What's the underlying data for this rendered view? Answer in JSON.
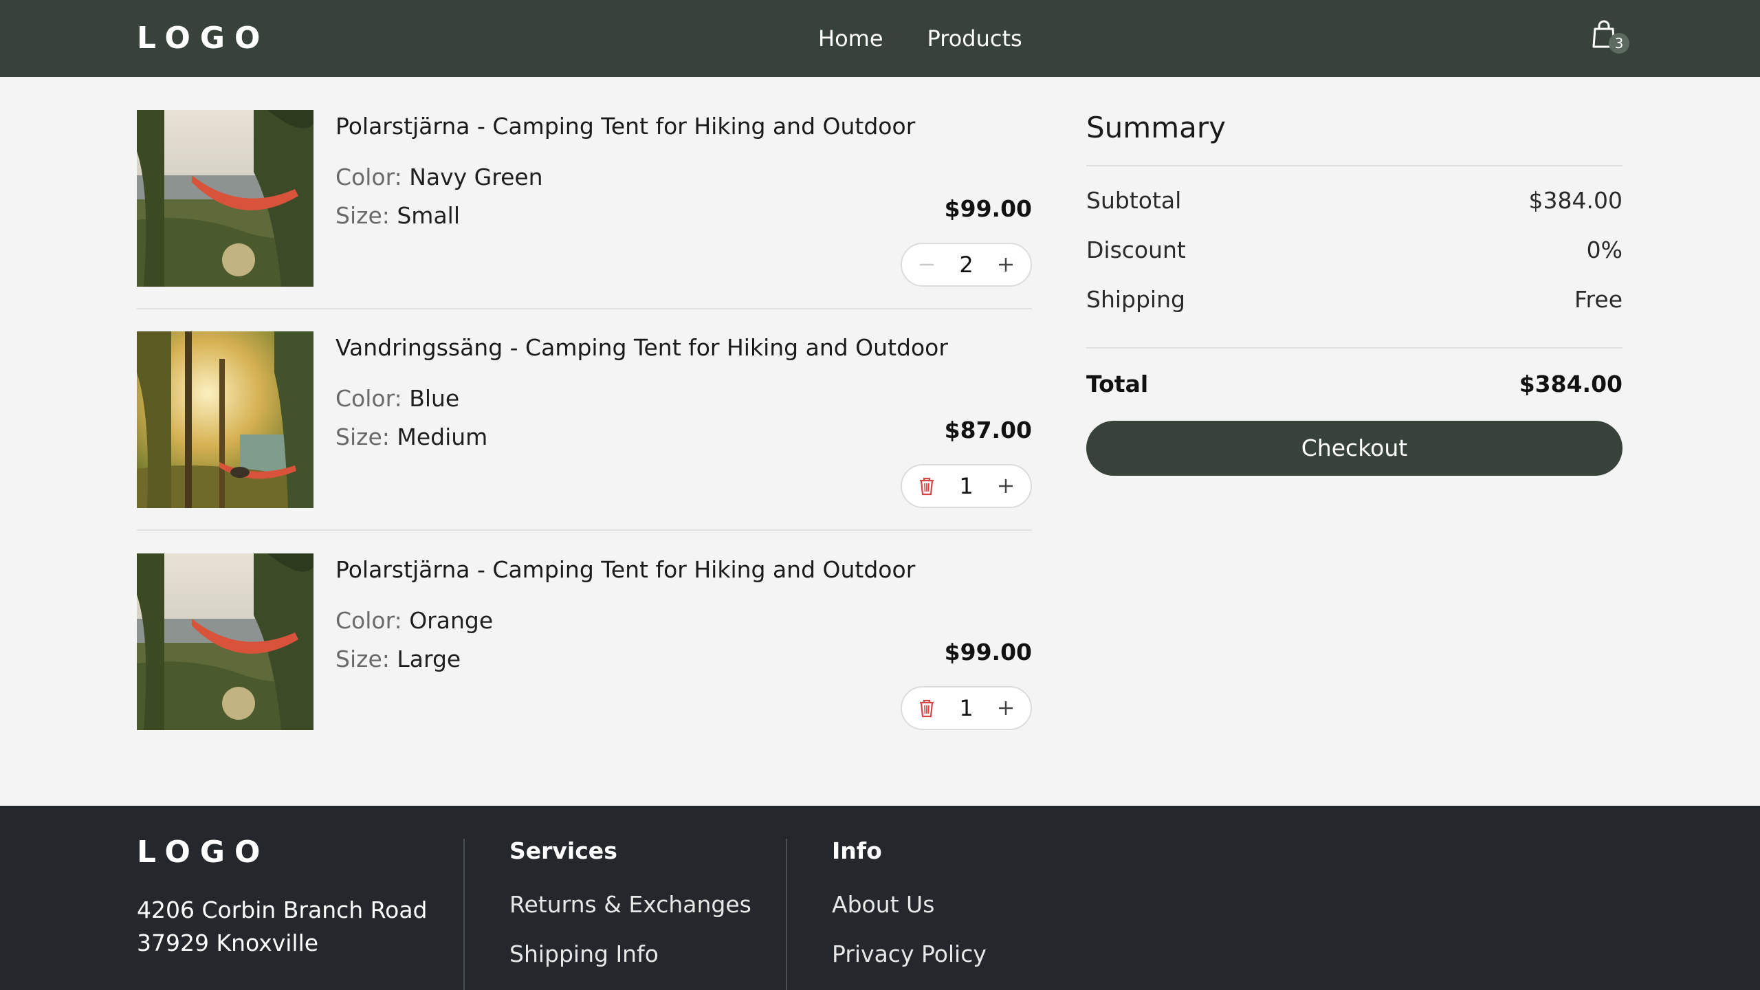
{
  "header": {
    "logo": "LOGO",
    "nav": [
      "Home",
      "Products"
    ],
    "cart_count": "3",
    "background": "#37433a"
  },
  "cart": {
    "items": [
      {
        "title": "Polarstjärna - Camping Tent for Hiking and Outdoor",
        "color_label": "Color:",
        "color_value": "Navy Green",
        "size_label": "Size:",
        "size_value": "Small",
        "price": "$99.00",
        "quantity": "2",
        "decrement_icon": "minus-icon"
      },
      {
        "title": "Vandringssäng - Camping Tent for Hiking and Outdoor",
        "color_label": "Color:",
        "color_value": "Blue",
        "size_label": "Size:",
        "size_value": "Medium",
        "price": "$87.00",
        "quantity": "1",
        "decrement_icon": "trash-icon"
      },
      {
        "title": "Polarstjärna - Camping Tent for Hiking and Outdoor",
        "color_label": "Color:",
        "color_value": "Orange",
        "size_label": "Size:",
        "size_value": "Large",
        "price": "$99.00",
        "quantity": "1",
        "decrement_icon": "trash-icon"
      }
    ]
  },
  "summary": {
    "title": "Summary",
    "rows": [
      {
        "label": "Subtotal",
        "value": "$384.00"
      },
      {
        "label": "Discount",
        "value": "0%"
      },
      {
        "label": "Shipping",
        "value": "Free"
      }
    ],
    "total_label": "Total",
    "total_value": "$384.00",
    "checkout_label": "Checkout"
  },
  "footer": {
    "logo": "LOGO",
    "address_line1": "4206 Corbin Branch Road",
    "address_line2": "37929 Knoxville",
    "services_title": "Services",
    "services_links": [
      "Returns & Exchanges",
      "Shipping Info"
    ],
    "info_title": "Info",
    "info_links": [
      "About Us",
      "Privacy Policy"
    ],
    "background": "#24272c"
  },
  "colors": {
    "accent": "#37433a",
    "trash": "#d64545",
    "page_bg": "#f4f4f4"
  }
}
